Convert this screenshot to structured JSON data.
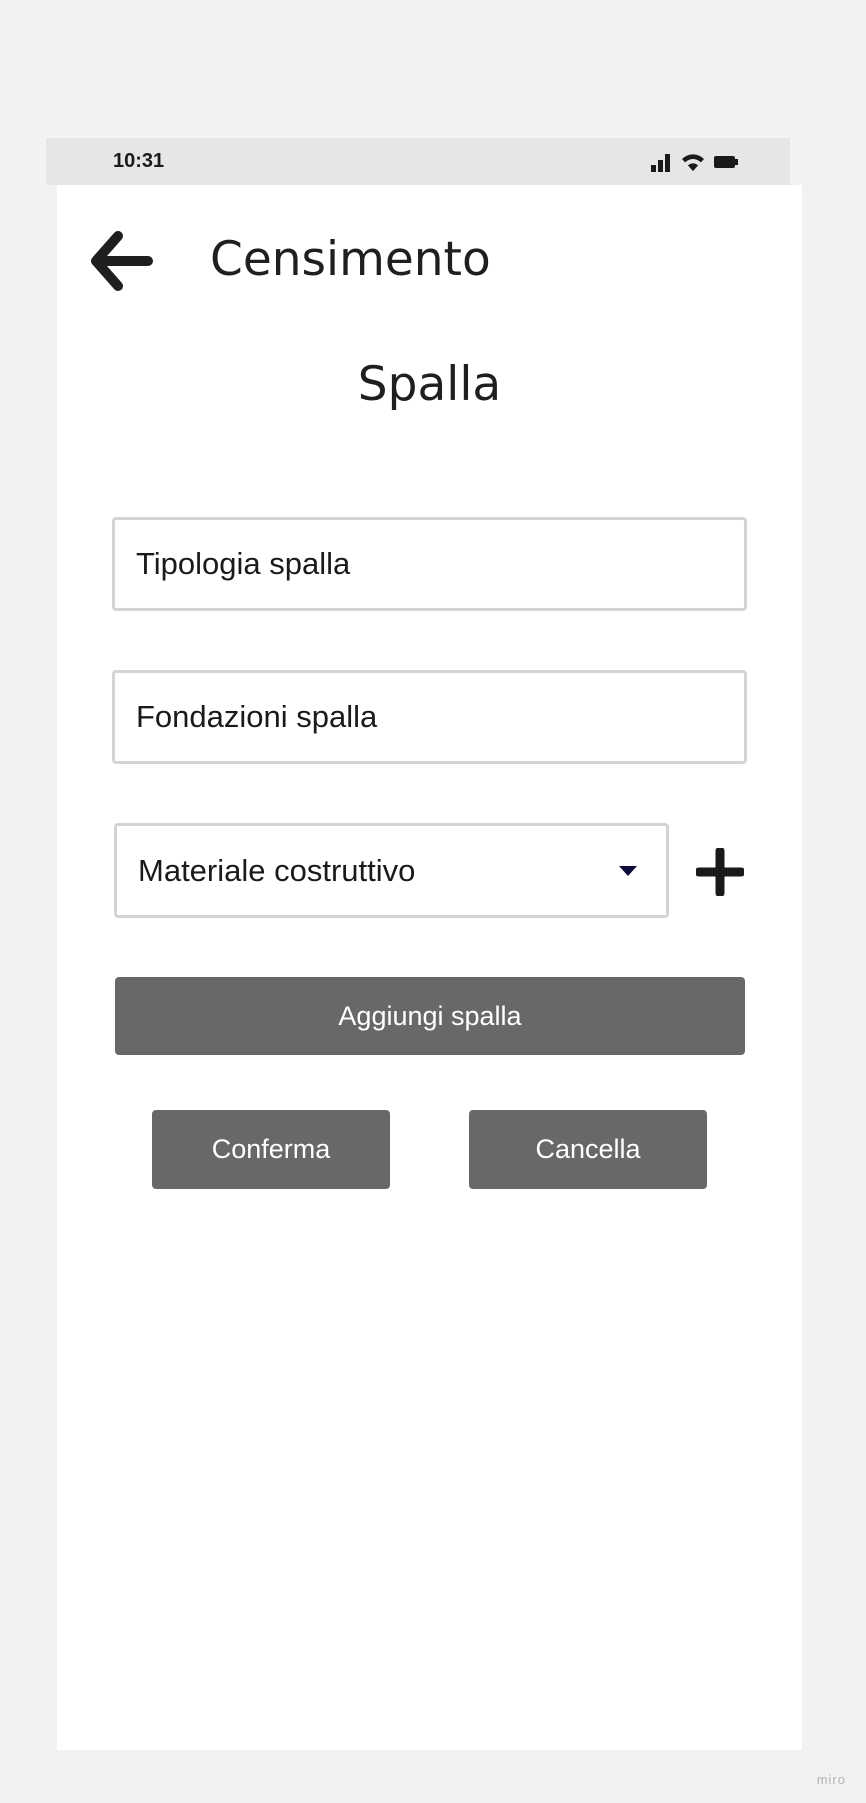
{
  "status_bar": {
    "time": "10:31",
    "icons": [
      "cellular-signal-icon",
      "wifi-icon",
      "battery-icon"
    ]
  },
  "header": {
    "back_icon": "arrow-left-icon",
    "title": "Censimento"
  },
  "form": {
    "section_title": "Spalla",
    "tipologia_placeholder": "Tipologia spalla",
    "fondazioni_placeholder": "Fondazioni spalla",
    "materiale_select": {
      "selected": "Materiale costruttivo",
      "icon": "caret-down-icon"
    },
    "add_material_icon": "plus-icon",
    "add_button_label": "Aggiungi spalla",
    "confirm_button_label": "Conferma",
    "cancel_button_label": "Cancella"
  },
  "watermark": "miro",
  "colors": {
    "page_background": "#f2f2f2",
    "status_bar_background": "#e6e6e6",
    "screen_background": "#ffffff",
    "button_background": "#686868",
    "button_text": "#ffffff",
    "field_border": "#d4d4d4",
    "text": "#1f1f1f",
    "dropdown_caret": "#0d0d3a"
  }
}
